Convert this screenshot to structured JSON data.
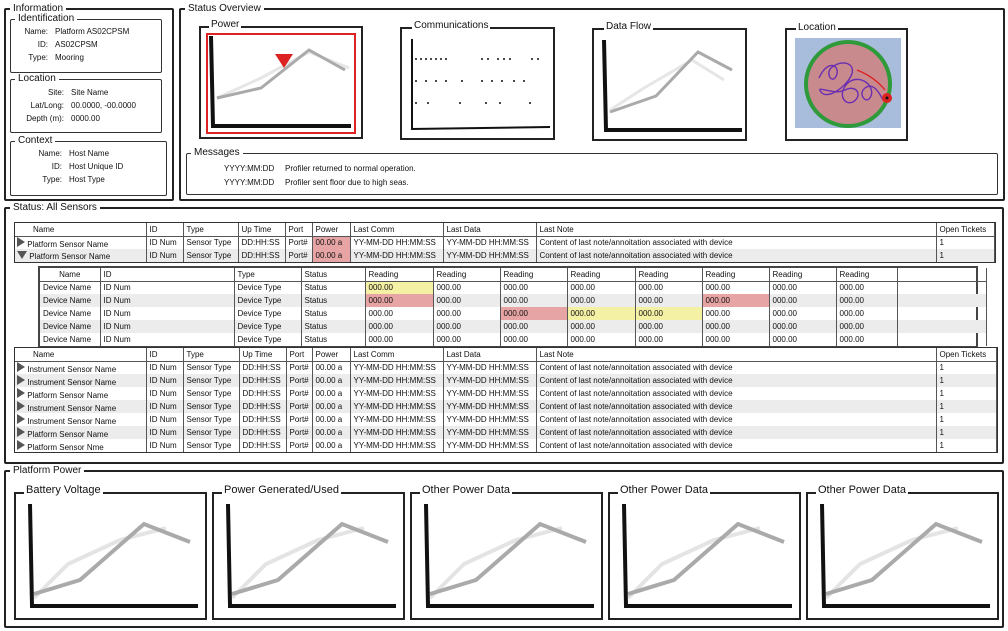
{
  "information": {
    "title": "Information",
    "identification": {
      "title": "Identification",
      "name_label": "Name:",
      "name_value": "Platform AS02CPSM",
      "id_label": "ID:",
      "id_value": "AS02CPSM",
      "type_label": "Type:",
      "type_value": "Mooring"
    },
    "location": {
      "title": "Location",
      "site_label": "Site:",
      "site_value": "Site Name",
      "latlong_label": "Lat/Long:",
      "latlong_value": "00.0000, -00.0000",
      "depth_label": "Depth (m):",
      "depth_value": "0000.00"
    },
    "context": {
      "title": "Context",
      "name_label": "Name:",
      "name_value": "Host Name",
      "id_label": "ID:",
      "id_value": "Host Unique ID",
      "type_label": "Type:",
      "type_value": "Host Type"
    }
  },
  "status_overview": {
    "title": "Status Overview",
    "panels": {
      "power": "Power",
      "communications": "Communications",
      "dataflow": "Data Flow",
      "location": "Location"
    },
    "messages": {
      "title": "Messages",
      "items": [
        {
          "date": "YYYY:MM:DD",
          "text": "Profiler returned to normal operation."
        },
        {
          "date": "YYYY:MM:DD",
          "text": "Profiler sent floor due to high seas."
        }
      ]
    }
  },
  "sensors": {
    "title": "Status: All Sensors",
    "headers": [
      "Name",
      "ID",
      "Type",
      "Up Time",
      "Port",
      "Power",
      "Last Comm",
      "Last Data",
      "Last Note",
      "Open Tickets"
    ],
    "platform_rows": [
      {
        "name": "Platform Sensor Name",
        "id": "ID Num",
        "type": "Sensor Type",
        "uptime": "DD:HH:SS",
        "port": "Port#",
        "power": "00.00 a",
        "last_comm": "YY-MM-DD HH:MM:SS",
        "last_data": "YY-MM-DD HH:MM:SS",
        "note": "Content of last note/annoitation associated with device",
        "tickets": "1"
      },
      {
        "name": "Platform Sensor Name",
        "id": "ID Num",
        "type": "Sensor Type",
        "uptime": "DD:HH:SS",
        "port": "Port#",
        "power": "00.00 a",
        "last_comm": "YY-MM-DD HH:MM:SS",
        "last_data": "YY-MM-DD HH:MM:SS",
        "note": "Content of last note/annoitation associated with device",
        "tickets": "1"
      }
    ],
    "device_headers": [
      "Name",
      "ID",
      "Type",
      "Status",
      "Reading",
      "Reading",
      "Reading",
      "Reading",
      "Reading",
      "Reading",
      "Reading",
      "Reading"
    ],
    "device_rows": [
      {
        "name": "Device Name",
        "id": "ID Num",
        "type": "Device Type",
        "status": "Status",
        "readings": [
          "000.00",
          "000.00",
          "000.00",
          "000.00",
          "000.00",
          "000.00",
          "000.00",
          "000.00"
        ]
      },
      {
        "name": "Device Name",
        "id": "ID Num",
        "type": "Device Type",
        "status": "Status",
        "readings": [
          "000.00",
          "000.00",
          "000.00",
          "000.00",
          "000.00",
          "000.00",
          "000.00",
          "000.00"
        ]
      },
      {
        "name": "Device Name",
        "id": "ID Num",
        "type": "Device Type",
        "status": "Status",
        "readings": [
          "000.00",
          "000.00",
          "000.00",
          "000.00",
          "000.00",
          "000.00",
          "000.00",
          "000.00"
        ]
      },
      {
        "name": "Device Name",
        "id": "ID Num",
        "type": "Device Type",
        "status": "Status",
        "readings": [
          "000.00",
          "000.00",
          "000.00",
          "000.00",
          "000.00",
          "000.00",
          "000.00",
          "000.00"
        ]
      },
      {
        "name": "Device Name",
        "id": "ID Num",
        "type": "Device Type",
        "status": "Status",
        "readings": [
          "000.00",
          "000.00",
          "000.00",
          "000.00",
          "000.00",
          "000.00",
          "000.00",
          "000.00"
        ]
      }
    ],
    "instrument_rows": [
      {
        "name": "Instrument Sensor Name",
        "id": "ID Num",
        "type": "Sensor Type",
        "uptime": "DD:HH:SS",
        "port": "Port#",
        "power": "00.00 a",
        "last_comm": "YY-MM-DD HH:MM:SS",
        "last_data": "YY-MM-DD HH:MM:SS",
        "note": "Content of last note/annoitation associated with device",
        "tickets": "1"
      },
      {
        "name": "Instrument Sensor Name",
        "id": "ID Num",
        "type": "Sensor Type",
        "uptime": "DD:HH:SS",
        "port": "Port#",
        "power": "00.00 a",
        "last_comm": "YY-MM-DD HH:MM:SS",
        "last_data": "YY-MM-DD HH:MM:SS",
        "note": "Content of last note/annoitation associated with device",
        "tickets": "1"
      },
      {
        "name": "Platform Sensor Name",
        "id": "ID Num",
        "type": "Sensor Type",
        "uptime": "DD:HH:SS",
        "port": "Port#",
        "power": "00.00 a",
        "last_comm": "YY-MM-DD HH:MM:SS",
        "last_data": "YY-MM-DD HH:MM:SS",
        "note": "Content of last note/annoitation associated with device",
        "tickets": "1"
      },
      {
        "name": "Instrument Sensor Name",
        "id": "ID Num",
        "type": "Sensor Type",
        "uptime": "DD:HH:SS",
        "port": "Port#",
        "power": "00.00 a",
        "last_comm": "YY-MM-DD HH:MM:SS",
        "last_data": "YY-MM-DD HH:MM:SS",
        "note": "Content of last note/annoitation associated with device",
        "tickets": "1"
      },
      {
        "name": "Instrument Sensor Name",
        "id": "ID Num",
        "type": "Sensor Type",
        "uptime": "DD:HH:SS",
        "port": "Port#",
        "power": "00.00 a",
        "last_comm": "YY-MM-DD HH:MM:SS",
        "last_data": "YY-MM-DD HH:MM:SS",
        "note": "Content of last note/annoitation associated with device",
        "tickets": "1"
      },
      {
        "name": "Platform Sensor Name",
        "id": "ID Num",
        "type": "Sensor Type",
        "uptime": "DD:HH:SS",
        "port": "Port#",
        "power": "00.00 a",
        "last_comm": "YY-MM-DD HH:MM:SS",
        "last_data": "YY-MM-DD HH:MM:SS",
        "note": "Content of last note/annoitation associated with device",
        "tickets": "1"
      },
      {
        "name": "Platform Sensor Nme",
        "id": "ID Num",
        "type": "Sensor Type",
        "uptime": "DD:HH:SS",
        "port": "Port#",
        "power": "00.00 a",
        "last_comm": "YY-MM-DD HH:MM:SS",
        "last_data": "YY-MM-DD HH:MM:SS",
        "note": "Content of last note/annoitation associated with device",
        "tickets": "1"
      }
    ]
  },
  "platform_power": {
    "title": "Platform Power",
    "charts": [
      "Battery Voltage",
      "Power Generated/Used",
      "Other Power Data",
      "Other Power Data",
      "Other Power Data"
    ]
  },
  "colors": {
    "alert_red": "#e7a4a4",
    "warn_yellow": "#f4f0a4",
    "map_water": "#a8bcdc",
    "map_disc": "#c98a8e",
    "map_ring": "#2f9a3a",
    "track_purple": "#6a2fb0"
  }
}
